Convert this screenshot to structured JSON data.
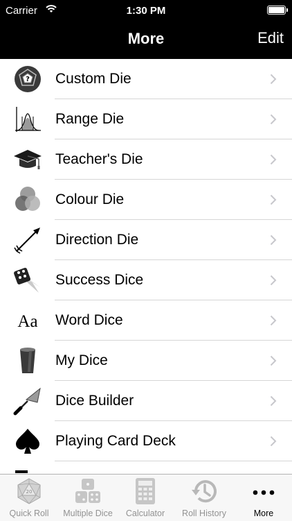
{
  "status_bar": {
    "carrier": "Carrier",
    "time": "1:30 PM"
  },
  "nav": {
    "title": "More",
    "edit_label": "Edit"
  },
  "list": {
    "items": [
      {
        "label": "Custom Die",
        "icon": "custom-die-icon"
      },
      {
        "label": "Range Die",
        "icon": "range-die-icon"
      },
      {
        "label": "Teacher's Die",
        "icon": "graduation-cap-icon"
      },
      {
        "label": "Colour Die",
        "icon": "colour-circles-icon"
      },
      {
        "label": "Direction Die",
        "icon": "arrow-icon"
      },
      {
        "label": "Success Dice",
        "icon": "flying-die-icon"
      },
      {
        "label": "Word Dice",
        "icon": "letters-icon"
      },
      {
        "label": "My Dice",
        "icon": "dice-cup-icon"
      },
      {
        "label": "Dice Builder",
        "icon": "trowel-icon"
      },
      {
        "label": "Playing Card Deck",
        "icon": "spade-icon"
      },
      {
        "label": "",
        "icon": "bars-icon"
      }
    ]
  },
  "custom_die_glyph": "?",
  "word_dice_glyph": "Aa",
  "quick_roll_glyph": "20",
  "tabbar": {
    "tabs": [
      {
        "label": "Quick Roll",
        "icon": "d20-icon"
      },
      {
        "label": "Multiple Dice",
        "icon": "dice-icon"
      },
      {
        "label": "Calculator",
        "icon": "calculator-icon"
      },
      {
        "label": "Roll History",
        "icon": "history-icon"
      },
      {
        "label": "More",
        "icon": "more-dots-icon"
      }
    ],
    "active": "More"
  }
}
